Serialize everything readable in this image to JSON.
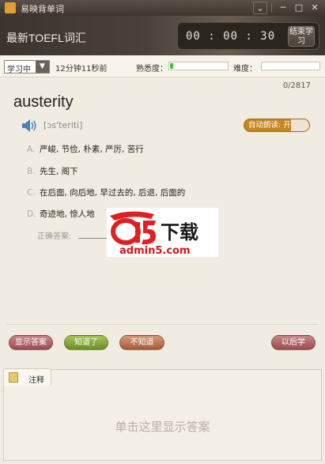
{
  "window": {
    "app_title": "易映背单词",
    "controls": {
      "dropdown": "⌄",
      "minimize": "─",
      "maximize": "□",
      "close": "✕"
    }
  },
  "header": {
    "deck_title": "最新TOEFL词汇",
    "timer": "00 : 00 : 30",
    "end_button": "结束学习"
  },
  "toolbar": {
    "mode": "学习中",
    "time_ago": "12分钟11秒前",
    "familiarity_label": "熟悉度：",
    "familiarity_progress": 0.05,
    "difficulty_label": "难度：",
    "difficulty_progress": 0
  },
  "card": {
    "counter": "0/2817",
    "word": "austerity",
    "phonetic": "[ɔs'teriti]",
    "auto_read": "自动朗读: 开",
    "options": [
      {
        "key": "A.",
        "text": "严峻, 节俭, 朴素, 严厉, 苦行"
      },
      {
        "key": "B.",
        "text": "先生, 阁下"
      },
      {
        "key": "C.",
        "text": "在后面, 向后地, 早过去的, 后退, 后面的"
      },
      {
        "key": "D.",
        "text": "奇迹地, 惊人地"
      }
    ],
    "answer_label": "正确答案:"
  },
  "watermark": {
    "brand": "a5下载",
    "url": "admin5.com"
  },
  "actions": {
    "show_answer": "显示答案",
    "know": "知道了",
    "dont_know": "不知道",
    "later": "以后学"
  },
  "notes": {
    "tab_label": "注释",
    "hint": "单击这里显示答案"
  },
  "colors": {
    "accent": "#c5861e",
    "progress": "#3ac43a"
  },
  "icons": {
    "speaker": "speaker-icon",
    "notes": "notes-icon"
  }
}
